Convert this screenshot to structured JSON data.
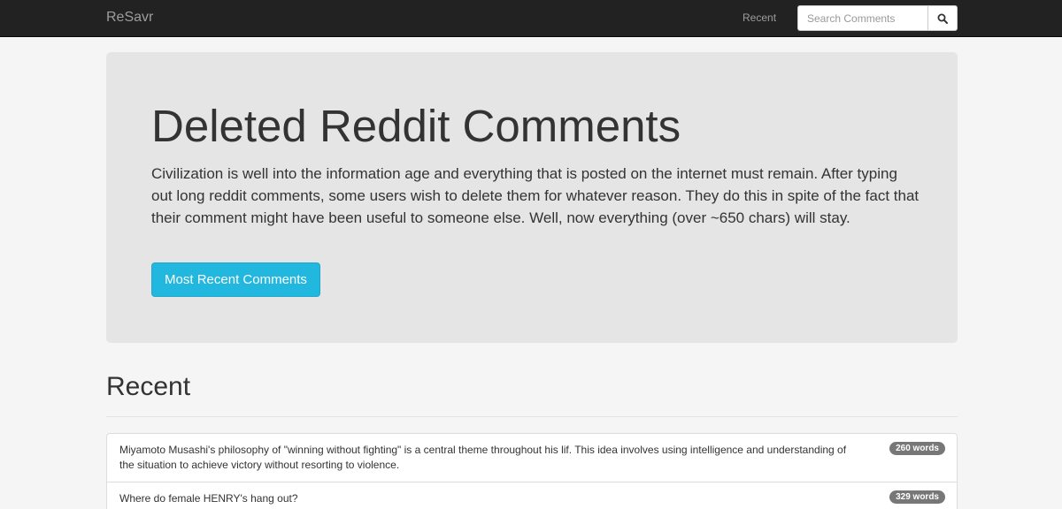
{
  "navbar": {
    "brand": "ReSavr",
    "recent_link": "Recent",
    "search": {
      "placeholder": "Search Comments",
      "value": ""
    },
    "search_button_icon": "search-icon"
  },
  "jumbotron": {
    "title": "Deleted Reddit Comments",
    "text": "Civilization is well into the information age and everything that is posted on the internet must remain. After typing out long reddit comments, some users wish to delete them for whatever reason. They do this in spite of the fact that their comment might have been useful to someone else. Well, now everything (over ~650 chars) will stay.",
    "button_label": "Most Recent Comments"
  },
  "recent": {
    "title": "Recent",
    "items": [
      {
        "text": "Miyamoto Musashi's philosophy of \"winning without fighting\" is a central theme throughout his lif. This idea involves using intelligence and understanding of the situation to achieve victory without resorting to violence.",
        "badge": "260 words"
      },
      {
        "text": "Where do female HENRY's hang out?",
        "badge": "329 words"
      }
    ]
  },
  "colors": {
    "navbar_bg": "#222222",
    "primary_button": "#22b7de",
    "jumbotron_bg": "#e5e5e5",
    "badge_bg": "#777777"
  }
}
